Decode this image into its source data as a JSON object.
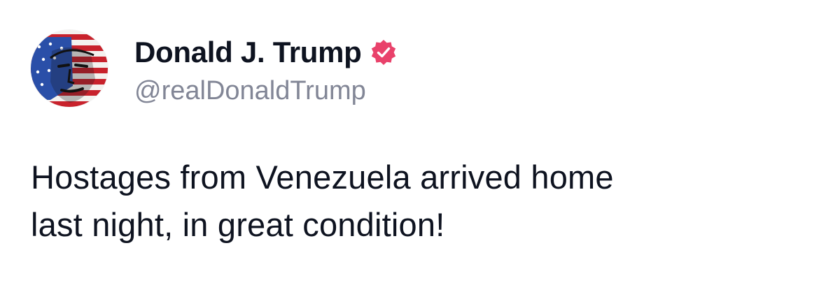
{
  "post": {
    "author": {
      "display_name": "Donald J. Trump",
      "handle": "@realDonaldTrump",
      "verified_badge_color": "#e9426b",
      "avatar_icon": "flag-portrait-avatar",
      "badge_icon": "verified-badge-icon"
    },
    "text_lines": [
      "Hostages from Venezuela arrived home",
      "last night, in great condition!"
    ]
  },
  "colors": {
    "text_primary": "#0e1320",
    "text_secondary": "#828696",
    "background": "#ffffff"
  }
}
